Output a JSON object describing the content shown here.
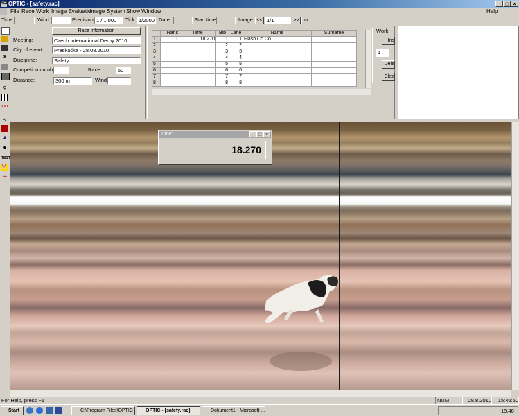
{
  "window": {
    "app_icon": "AGE",
    "title": "OPTIC - [safety.rac]",
    "help": "Help"
  },
  "menu": [
    "File",
    "Race",
    "Work",
    "Image Evaluation",
    "Image",
    "System",
    "Show",
    "Window"
  ],
  "toolbar": {
    "time_label": "Time:",
    "wind_label": "Wind:",
    "precision_label": "Precision:",
    "precision_value": "1 / 1 000",
    "tick_label": "Tick:",
    "tick_value": "1/2000",
    "date_label": "Date:",
    "start_label": "Start time",
    "image_label": "Image:",
    "image_value": "1/1",
    "prev": "<<",
    "next": ">>",
    "loop": "∞"
  },
  "race_info": {
    "header": "Race information",
    "meeting_label": "Meeting:",
    "meeting": "Czech International Derby 2010",
    "city_label": "City of event:",
    "city": "Praskačka - 28.08.2010",
    "discipline_label": "Discipline:",
    "discipline": "Safety",
    "competition_label": "Competion number:",
    "competition": "",
    "race_label": "Race",
    "race": "50",
    "distance_label": "Distance:",
    "distance": "300 m",
    "wind_label": "Wind:",
    "wind": ""
  },
  "grid": {
    "headers": [
      "Rank",
      "Time",
      "Bib",
      "Lane",
      "Name",
      "Surname"
    ],
    "rows": [
      {
        "n": "1",
        "rank": "1",
        "time": "18.270",
        "bib": "1",
        "lane": "1",
        "name": "Flash Co Co",
        "surname": ""
      },
      {
        "n": "2",
        "rank": "",
        "time": "",
        "bib": "2",
        "lane": "2",
        "name": "",
        "surname": ""
      },
      {
        "n": "3",
        "rank": "",
        "time": "",
        "bib": "3",
        "lane": "3",
        "name": "",
        "surname": ""
      },
      {
        "n": "4",
        "rank": "",
        "time": "",
        "bib": "4",
        "lane": "4",
        "name": "",
        "surname": ""
      },
      {
        "n": "5",
        "rank": "",
        "time": "",
        "bib": "5",
        "lane": "5",
        "name": "",
        "surname": ""
      },
      {
        "n": "6",
        "rank": "",
        "time": "",
        "bib": "6",
        "lane": "6",
        "name": "",
        "surname": ""
      },
      {
        "n": "7",
        "rank": "",
        "time": "",
        "bib": "7",
        "lane": "7",
        "name": "",
        "surname": ""
      },
      {
        "n": "8",
        "rank": "",
        "time": "",
        "bib": "8",
        "lane": "8",
        "name": "",
        "surname": ""
      }
    ]
  },
  "work_panel": {
    "title": "Work",
    "buttons": [
      "Ins",
      "Dele",
      "Clea"
    ],
    "spin_value": "1"
  },
  "time_popup": {
    "caption": "Time:",
    "value": "18.270"
  },
  "status": {
    "help_text": "For Help, press F1",
    "num": "NUM",
    "date": "28.8.2010",
    "time": "15:46:50"
  },
  "taskbar": {
    "start": "Start",
    "tasks": [
      "C:\\Program Files\\OPTIC-...",
      "OPTIC - [safety.rac]",
      "Dokument1 - Microsoft ..."
    ],
    "clock": "15:46"
  },
  "icons": [
    "new-file-icon",
    "open-folder-icon",
    "save-icon",
    "delete-icon",
    "print-icon",
    "preview-icon",
    "zoom-icon",
    "barcode-icon",
    "logo-icon",
    "pointer-icon",
    "red-block-icon",
    "person-icon",
    "horse-icon",
    "test-icon",
    "dog-icon",
    "arrow-icon"
  ],
  "colors": {
    "titlebar": "#0a246a",
    "finish_line": "#1a1a1a",
    "face": "#d4d0c8"
  }
}
